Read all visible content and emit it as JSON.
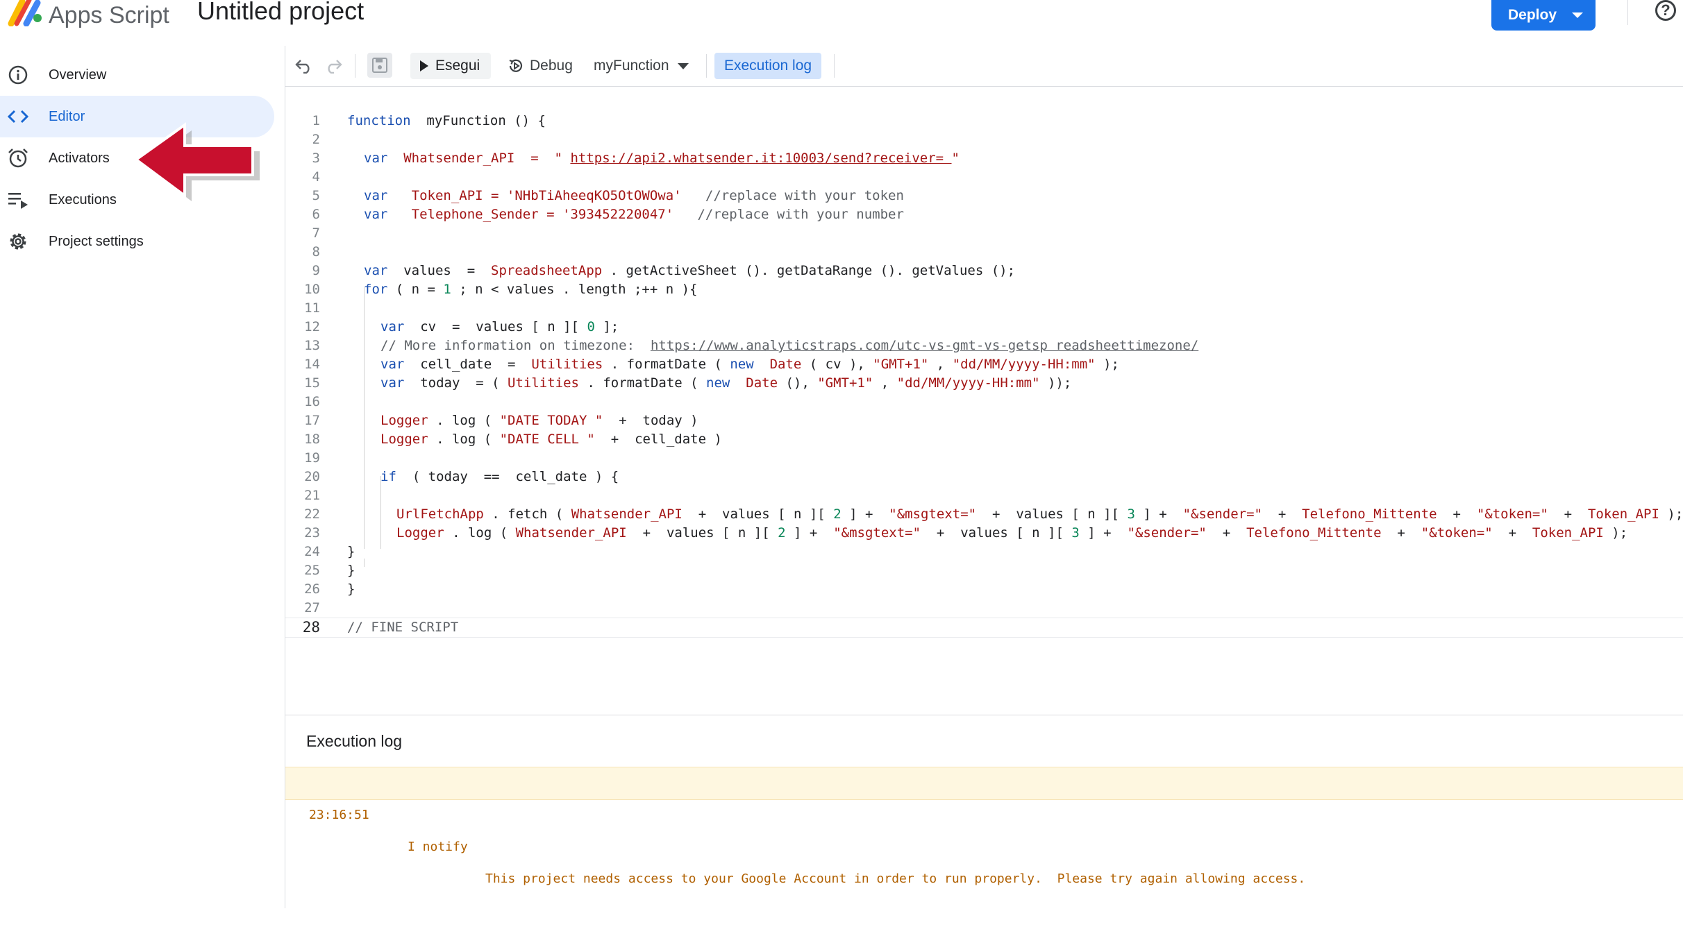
{
  "header": {
    "app_name": "Apps Script",
    "project_title": "Untitled project",
    "deploy_label": "Deploy",
    "help_label": "?"
  },
  "sidebar": {
    "items": [
      {
        "label": "Overview",
        "icon": "info-icon",
        "active": false
      },
      {
        "label": "Editor",
        "icon": "code-icon",
        "active": true
      },
      {
        "label": "Activators",
        "icon": "alarm-clock-icon",
        "active": false
      },
      {
        "label": "Executions",
        "icon": "executions-list-icon",
        "active": false
      },
      {
        "label": "Project settings",
        "icon": "gear-icon",
        "active": false
      }
    ]
  },
  "toolbar": {
    "run_label": "Esegui",
    "debug_label": "Debug",
    "function_name": "myFunction",
    "execution_log_label": "Execution log"
  },
  "code": {
    "line_numbers": [
      "1",
      "2",
      "3",
      "4",
      "5",
      "6",
      "7",
      "8",
      "9",
      "10",
      "11",
      "12",
      "13",
      "14",
      "15",
      "16",
      "17",
      "18",
      "19",
      "20",
      "21",
      "22",
      "23",
      "24",
      "25",
      "26",
      "27",
      "28"
    ],
    "l1": {
      "kw": "function",
      "rest": "  myFunction () {"
    },
    "l3": {
      "kw": "var",
      "name": "  Whatsender_API  =  ",
      "str_open": "\" ",
      "url": "https://api2.whatsender.it:10003/send?receiver= ",
      "str_close": "\""
    },
    "l5": {
      "kw": "var",
      "name": "   Token_API = ",
      "str": "'NHbTiAheeqKO5OtOWOwa'",
      "comment": "   //replace with your token"
    },
    "l6": {
      "kw": "var",
      "name": "   Telephone_Sender = ",
      "str": "'393452220047'",
      "comment": "   //replace with your number"
    },
    "l9": {
      "kw": "var",
      "p1": "  values  =  ",
      "cls": "SpreadsheetApp",
      "p2": " . getActiveSheet (). getDataRange (). getValues ();"
    },
    "l10": {
      "kw": "for",
      "p1": " ( n = ",
      "num": "1",
      "p2": " ; n < values . length ;++ n ){"
    },
    "l12": {
      "kw": "var",
      "p1": "  cv  =  values [ n ][ ",
      "num": "0",
      "p2": " ];"
    },
    "l13": {
      "comment": "// More information on timezone:  ",
      "url": "https://www.analyticstraps.com/utc-vs-gmt-vs-getsp readsheettimezone/"
    },
    "l14": {
      "kw": "var",
      "p1": "  cell_date  =  ",
      "cls": "Utilities",
      "p2": " . formatDate ( ",
      "kw2": "new",
      "p3": "  ",
      "cls2": "Date",
      "p4": " ( cv ), ",
      "s1": "\"GMT+1\"",
      "p5": " , ",
      "s2": "\"dd/MM/yyyy-HH:mm\"",
      "p6": " );"
    },
    "l15": {
      "kw": "var",
      "p1": "  today  = ( ",
      "cls": "Utilities",
      "p2": " . formatDate ( ",
      "kw2": "new",
      "p3": "  ",
      "cls2": "Date",
      "p4": " (), ",
      "s1": "\"GMT+1\"",
      "p5": " , ",
      "s2": "\"dd/MM/yyyy-HH:mm\"",
      "p6": " ));"
    },
    "l17": {
      "cls": "Logger",
      "p1": " . log ( ",
      "str": "\"DATE TODAY \"",
      "p2": "  +  today )"
    },
    "l18": {
      "cls": "Logger",
      "p1": " . log ( ",
      "str": "\"DATE CELL \"",
      "p2": "  +  cell_date )"
    },
    "l20": {
      "kw": "if",
      "p1": "  ( today  ==  cell_date ) {"
    },
    "l22": {
      "cls": "UrlFetchApp",
      "p1": " . fetch ( ",
      "v1": "Whatsender_API",
      "p2": "  +  values [ n ][ ",
      "n1": "2",
      "p3": " ] +  ",
      "s1": "\"&msgtext=\"",
      "p4": "  +  values [ n ][ ",
      "n2": "3",
      "p5": " ] +  ",
      "s2": "\"&sender=\"",
      "p6": "  +  ",
      "v2": "Telefono_Mittente",
      "p7": "  +  ",
      "s3": "\"&token=\"",
      "p8": "  +  ",
      "v3": "Token_API",
      "p9": " );"
    },
    "l23": {
      "cls": "Logger",
      "p1": " . log ( ",
      "v1": "Whatsender_API",
      "p2": "  +  values [ n ][ ",
      "n1": "2",
      "p3": " ] +  ",
      "s1": "\"&msgtext=\"",
      "p4": "  +  values [ n ][ ",
      "n2": "3",
      "p5": " ] +  ",
      "s2": "\"&sender=\"",
      "p6": "  +  ",
      "v2": "Telefono_Mittente",
      "p7": "  +  ",
      "s3": "\"&token=\"",
      "p8": "  +  ",
      "v3": "Token_API",
      "p9": " );"
    },
    "l24": "}",
    "l25": "}",
    "l26": "}",
    "l28": {
      "comment": "// FINE SCRIPT"
    }
  },
  "log": {
    "title": "Execution log",
    "entries": [
      {
        "time": "23:16:51",
        "level": "I notify",
        "message": "This project needs access to your Google Account in order to run properly.  Please try again allowing access."
      }
    ]
  },
  "colors": {
    "accent": "#1a73e8",
    "active_nav_bg": "#e8f0fe",
    "log_warning_bg": "#fef7e0",
    "arrow": "#c8102e"
  }
}
